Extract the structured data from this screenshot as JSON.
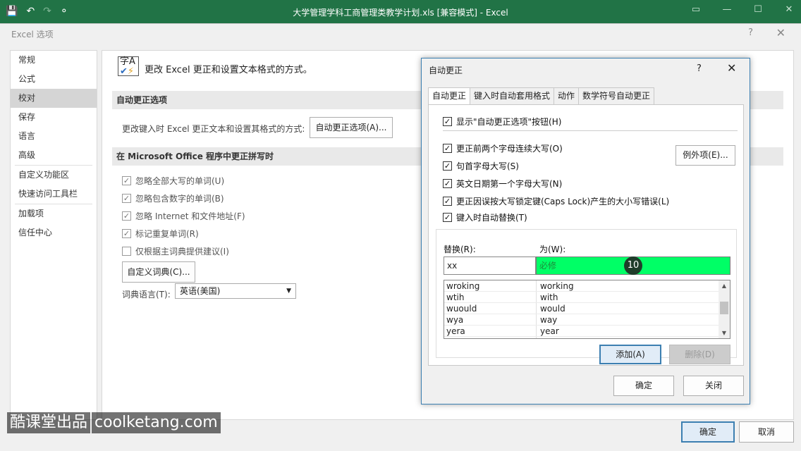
{
  "titlebar": {
    "title": "大学管理学科工商管理类教学计划.xls  [兼容模式] - Excel",
    "save_icon": "💾",
    "undo_icon": "↶",
    "redo_icon": "↷",
    "customize_icon": "⚬",
    "controls": [
      "▭",
      "—",
      "☐",
      "✕"
    ]
  },
  "options_dialog": {
    "title": "Excel 选项",
    "help": "?",
    "close": "✕",
    "nav": [
      "常规",
      "公式",
      "校对",
      "保存",
      "语言",
      "高级",
      "自定义功能区",
      "快速访问工具栏",
      "加载项",
      "信任中心"
    ],
    "active_nav": "校对",
    "header_text": "更改 Excel 更正和设置文本格式的方式。",
    "section_autocorrect": "自动更正选项",
    "autocorrect_desc": "更改键入时 Excel 更正文本和设置其格式的方式:",
    "autocorrect_button": "自动更正选项(A)...",
    "section_spelling": "在 Microsoft Office 程序中更正拼写时",
    "spelling_options": [
      {
        "label": "忽略全部大写的单词(U)",
        "checked": true
      },
      {
        "label": "忽略包含数字的单词(B)",
        "checked": true
      },
      {
        "label": "忽略 Internet 和文件地址(F)",
        "checked": true
      },
      {
        "label": "标记重复单词(R)",
        "checked": true
      },
      {
        "label": "仅根据主词典提供建议(I)",
        "checked": false
      }
    ],
    "custom_dict_button": "自定义词典(C)...",
    "dict_lang_label": "词典语言(T):",
    "dict_lang_value": "英语(美国)",
    "ok": "确定",
    "cancel": "取消"
  },
  "autocorrect_dialog": {
    "title": "自动更正",
    "help": "?",
    "close": "✕",
    "tabs": [
      "自动更正",
      "键入时自动套用格式",
      "动作",
      "数学符号自动更正"
    ],
    "active_tab": "自动更正",
    "show_button_option": "显示\"自动更正选项\"按钮(H)",
    "options": [
      {
        "label": "更正前两个字母连续大写(O)",
        "checked": true
      },
      {
        "label": "句首字母大写(S)",
        "checked": true
      },
      {
        "label": "英文日期第一个字母大写(N)",
        "checked": true
      },
      {
        "label": "更正因误按大写锁定键(Caps Lock)产生的大小写错误(L)",
        "checked": true
      },
      {
        "label": "键入时自动替换(T)",
        "checked": true
      }
    ],
    "exceptions_button": "例外项(E)...",
    "replace_label": "替换(R):",
    "with_label": "为(W):",
    "replace_value": "xx",
    "with_value": "必修",
    "step_marker": "10",
    "list": [
      {
        "from": "wroking",
        "to": "working"
      },
      {
        "from": "wtih",
        "to": "with"
      },
      {
        "from": "wuould",
        "to": "would"
      },
      {
        "from": "wya",
        "to": "way"
      },
      {
        "from": "yera",
        "to": "year"
      }
    ],
    "add_button": "添加(A)",
    "delete_button": "删除(D)",
    "ok": "确定",
    "close_button": "关闭"
  },
  "watermark": [
    "酷课堂出品",
    "coolketang.com"
  ]
}
